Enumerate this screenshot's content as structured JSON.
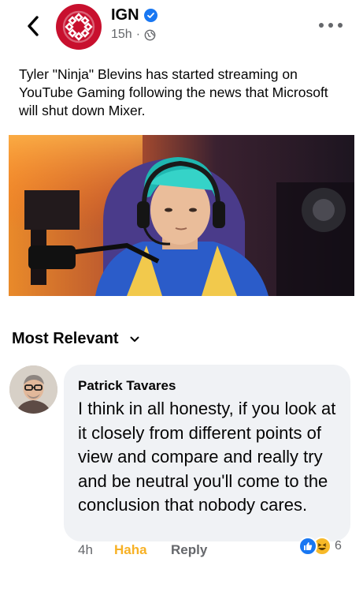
{
  "post": {
    "page_name": "IGN",
    "time": "15h",
    "separator": "·",
    "text": "Tyler \"Ninja\" Blevins has started streaming on YouTube Gaming following the news that Microsoft will shut down Mixer."
  },
  "comments_section": {
    "sort_label": "Most Relevant"
  },
  "comment": {
    "author": "Patrick Tavares",
    "text": "I think in all honesty, if you look at it closely from different points of view and compare and really try and be neutral you'll come to the conclusion that nobody cares.",
    "time": "4h",
    "reaction_label": "Haha",
    "reply_label": "Reply",
    "reaction_count": "6"
  },
  "icons": {
    "back": "chevron-left-icon",
    "verified": "verified-badge-icon",
    "audience": "globe-icon",
    "more": "more-options-icon",
    "sort": "chevron-down-icon",
    "reactions": [
      "like-reaction-icon",
      "haha-reaction-icon"
    ]
  },
  "colors": {
    "ign_red": "#c8102e",
    "facebook_blue": "#1877f2",
    "haha_yellow": "#f7b125",
    "secondary_text": "#65676b",
    "bubble_bg": "#f0f2f5"
  }
}
